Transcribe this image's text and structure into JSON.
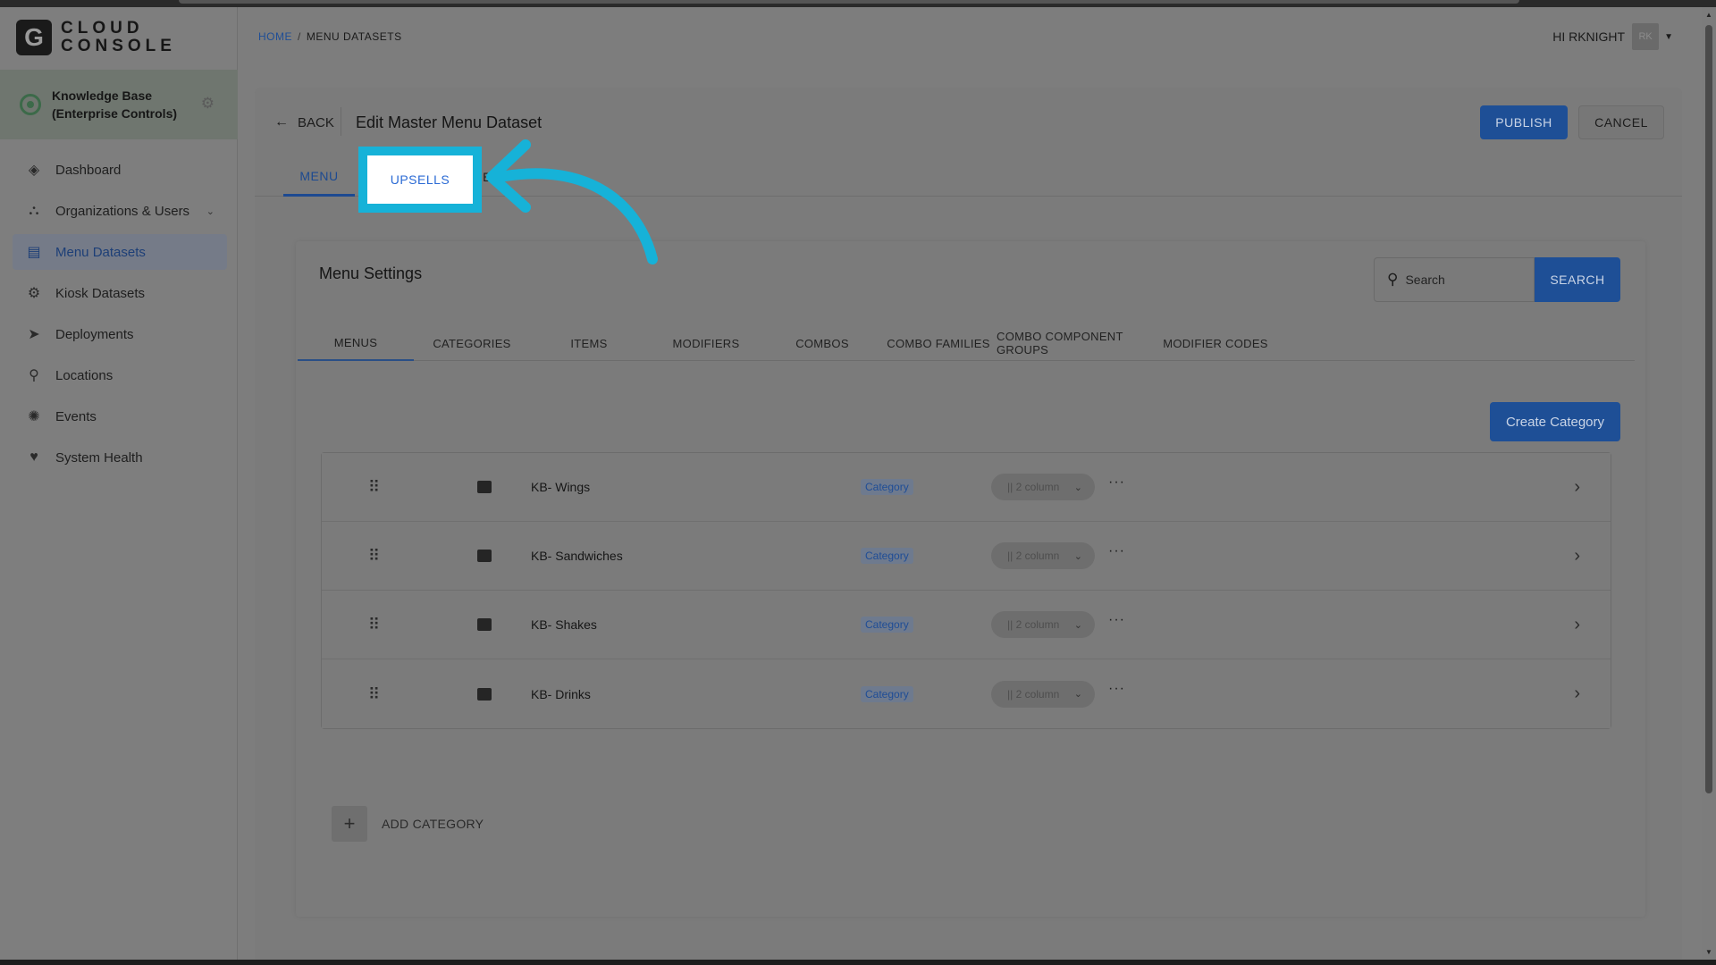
{
  "brand": {
    "logo_letter": "G",
    "line1": "CLOUD",
    "line2": "CONSOLE"
  },
  "org": {
    "name_line1": "Knowledge Base",
    "name_line2": "(Enterprise Controls)"
  },
  "sidebar": {
    "items": [
      {
        "label": "Dashboard",
        "icon": "layers-icon"
      },
      {
        "label": "Organizations & Users",
        "icon": "org-chart-icon"
      },
      {
        "label": "Menu Datasets",
        "icon": "menu-dataset-icon"
      },
      {
        "label": "Kiosk Datasets",
        "icon": "kiosk-gear-icon"
      },
      {
        "label": "Deployments",
        "icon": "paper-plane-icon"
      },
      {
        "label": "Locations",
        "icon": "map-pin-icon"
      },
      {
        "label": "Events",
        "icon": "events-icon"
      },
      {
        "label": "System Health",
        "icon": "heart-pulse-icon"
      }
    ]
  },
  "breadcrumb": {
    "home": "HOME",
    "separator": "/",
    "current": "MENU DATASETS"
  },
  "user": {
    "greeting": "HI RKNIGHT",
    "initials": "RK"
  },
  "page": {
    "back_label": "BACK",
    "title": "Edit Master Menu Dataset",
    "publish_label": "PUBLISH",
    "cancel_label": "CANCEL"
  },
  "tabs": {
    "menu": "MENU",
    "upsells": "UPSELLS",
    "hidden_partial": "E"
  },
  "panel": {
    "title": "Menu Settings",
    "search_placeholder": "Search",
    "search_button": "SEARCH",
    "subtabs": [
      "MENUS",
      "CATEGORIES",
      "ITEMS",
      "MODIFIERS",
      "COMBOS",
      "COMBO FAMILIES",
      "COMBO COMPONENT GROUPS",
      "MODIFIER CODES"
    ],
    "create_button": "Create Category",
    "add_label": "ADD CATEGORY"
  },
  "rows": [
    {
      "name": "KB- Wings",
      "badge": "Category",
      "layout": "|| 2 column"
    },
    {
      "name": "KB- Sandwiches",
      "badge": "Category",
      "layout": "|| 2 column"
    },
    {
      "name": "KB- Shakes",
      "badge": "Category",
      "layout": "|| 2 column"
    },
    {
      "name": "KB- Drinks",
      "badge": "Category",
      "layout": "|| 2 column"
    }
  ],
  "colors": {
    "primary": "#1e4f96",
    "highlight": "#16b2d8",
    "overlay": "#7b7b7b"
  }
}
